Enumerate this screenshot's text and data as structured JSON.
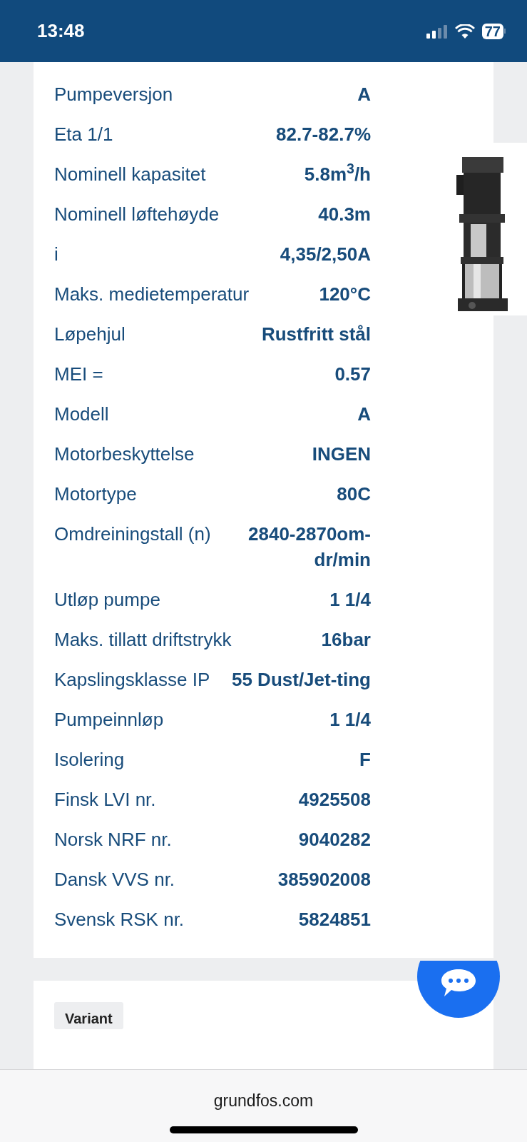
{
  "status_bar": {
    "time": "13:48",
    "battery": "77"
  },
  "specs": [
    {
      "label": "Pumpeversjon",
      "value": "A"
    },
    {
      "label": "Eta 1/1",
      "value": "82.7-82.7%"
    },
    {
      "label": "Nominell kapasitet",
      "value": "5.8m$^{3}$/h"
    },
    {
      "label": "Nominell løftehøyde",
      "value": "40.3m"
    },
    {
      "label": "i",
      "value": "4,35/2,50A"
    },
    {
      "label": "Maks. medietemperatur",
      "value": "120°C"
    },
    {
      "label": "Løpehjul",
      "value": "Rustfritt stål"
    },
    {
      "label": "MEI =",
      "value": "0.57"
    },
    {
      "label": "Modell",
      "value": "A"
    },
    {
      "label": "Motorbeskyttelse",
      "value": "INGEN"
    },
    {
      "label": "Motortype",
      "value": "80C"
    },
    {
      "label": "Omdreiningstall (n)",
      "value": "2840-2870om-dr/min"
    },
    {
      "label": "Utløp pumpe",
      "value": "1 1/4"
    },
    {
      "label": "Maks. tillatt driftstrykk",
      "value": "16bar"
    },
    {
      "label": "Kapslingsklasse IP",
      "value": "55 Dust/Jet-ting"
    },
    {
      "label": "Pumpeinnløp",
      "value": "1 1/4"
    },
    {
      "label": "Isolering",
      "value": "F"
    },
    {
      "label": "Finsk LVI nr.",
      "value": "4925508"
    },
    {
      "label": "Norsk NRF nr.",
      "value": "9040282"
    },
    {
      "label": "Dansk VVS nr.",
      "value": "385902008"
    },
    {
      "label": "Svensk RSK nr.",
      "value": "5824851"
    }
  ],
  "next_section": {
    "tab": "Variant"
  },
  "browser": {
    "url": "grundfos.com"
  }
}
